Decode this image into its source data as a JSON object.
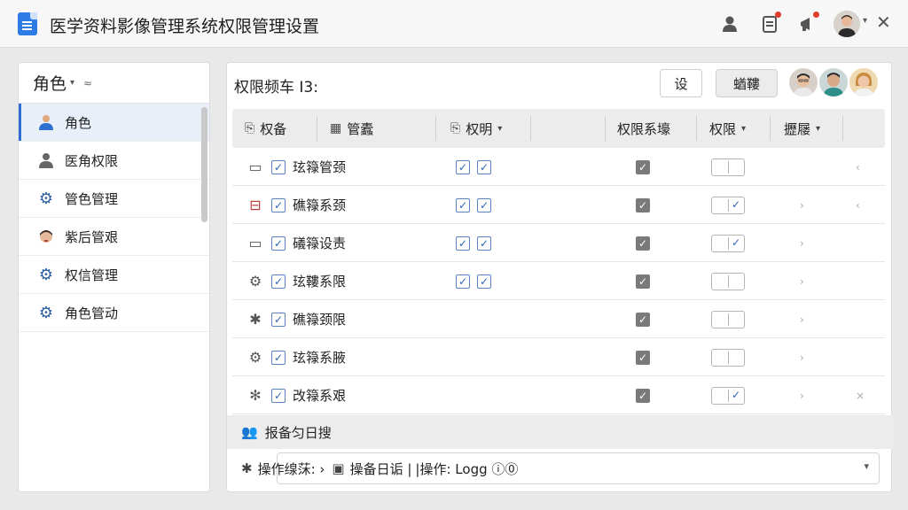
{
  "window": {
    "title": "医学资料影像管理系统权限管理设置"
  },
  "sidebar": {
    "header": "角色",
    "items": [
      {
        "label": "角色",
        "icon": "user-icon",
        "active": true
      },
      {
        "label": "医角权限",
        "icon": "user-gray-icon",
        "active": false
      },
      {
        "label": "管色管理",
        "icon": "gear-icon",
        "active": false
      },
      {
        "label": "紫后管艰",
        "icon": "person-face-icon",
        "active": false
      },
      {
        "label": "权信管理",
        "icon": "gear-icon",
        "active": false
      },
      {
        "label": "角色管动",
        "icon": "gear-icon",
        "active": false
      }
    ]
  },
  "main": {
    "title": "权限频车 I3:",
    "button_set": "设",
    "button_confirm": "蝤鞻",
    "columns": {
      "c1": "权备",
      "c2": "管蠹",
      "c3": "权明",
      "c4": "权限系壕",
      "c5": "权限",
      "c6": "攊屦"
    },
    "rows": [
      {
        "label": "玹簶管颈",
        "icon": "monitor-icon",
        "perm_checks": 2,
        "system": true,
        "toggle": false,
        "mark1": "",
        "mark2": "‹"
      },
      {
        "label": "礁簶系颈",
        "icon": "pill-icon",
        "perm_checks": 2,
        "system": true,
        "toggle": true,
        "mark1": "›",
        "mark2": "‹"
      },
      {
        "label": "礒簶设责",
        "icon": "monitor-icon",
        "perm_checks": 2,
        "system": true,
        "toggle": true,
        "mark1": "›",
        "mark2": ""
      },
      {
        "label": "玹鞻系限",
        "icon": "gear-icon",
        "perm_checks": 2,
        "system": true,
        "toggle": false,
        "mark1": "›",
        "mark2": ""
      },
      {
        "label": "礁簶颈限",
        "icon": "asterisk-icon",
        "perm_checks": 0,
        "system": true,
        "toggle": false,
        "mark1": "›",
        "mark2": ""
      },
      {
        "label": "玹簶系腋",
        "icon": "gear-icon",
        "perm_checks": 0,
        "system": true,
        "toggle": false,
        "mark1": "›",
        "mark2": ""
      },
      {
        "label": "改簶系艰",
        "icon": "sparkle-gear-icon",
        "perm_checks": 0,
        "system": true,
        "toggle": true,
        "mark1": "›",
        "mark2": "×"
      }
    ],
    "footer_title": "报备匀日搜",
    "footer_line_a": "操作缐莯: ›",
    "footer_line_b": "操备日诟 |",
    "footer_line_c": "|操作: Logg ⓘ⓪"
  },
  "colors": {
    "accent": "#2f6fd1",
    "checkbox": "#2e64b8",
    "red_badge": "#e23b2e"
  }
}
